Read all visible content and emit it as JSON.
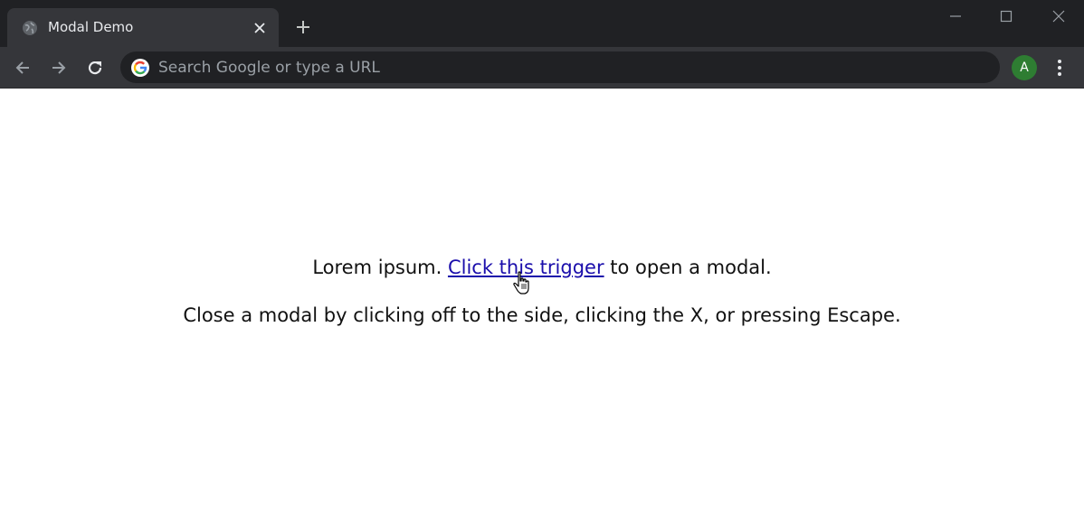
{
  "browser": {
    "tab": {
      "title": "Modal Demo"
    },
    "omnibox": {
      "placeholder": "Search Google or type a URL"
    },
    "avatar": {
      "initial": "A",
      "color": "#2e7d32"
    }
  },
  "page": {
    "line1": {
      "before": "Lorem ipsum. ",
      "link": "Click this trigger",
      "after": " to open a modal."
    },
    "line2": "Close a modal by clicking off to the side, clicking the X, or pressing Escape."
  },
  "colors": {
    "link": "#1a0dab",
    "chrome_dark": "#202124",
    "chrome_toolbar": "#35363a"
  },
  "icons": {
    "tab_favicon": "globe-icon",
    "tab_close": "close-icon",
    "new_tab": "plus-icon",
    "back": "arrow-left-icon",
    "forward": "arrow-right-icon",
    "reload": "reload-icon",
    "search_engine": "google-icon",
    "menu": "kebab-menu-icon",
    "pointer": "hand-pointer-icon"
  }
}
